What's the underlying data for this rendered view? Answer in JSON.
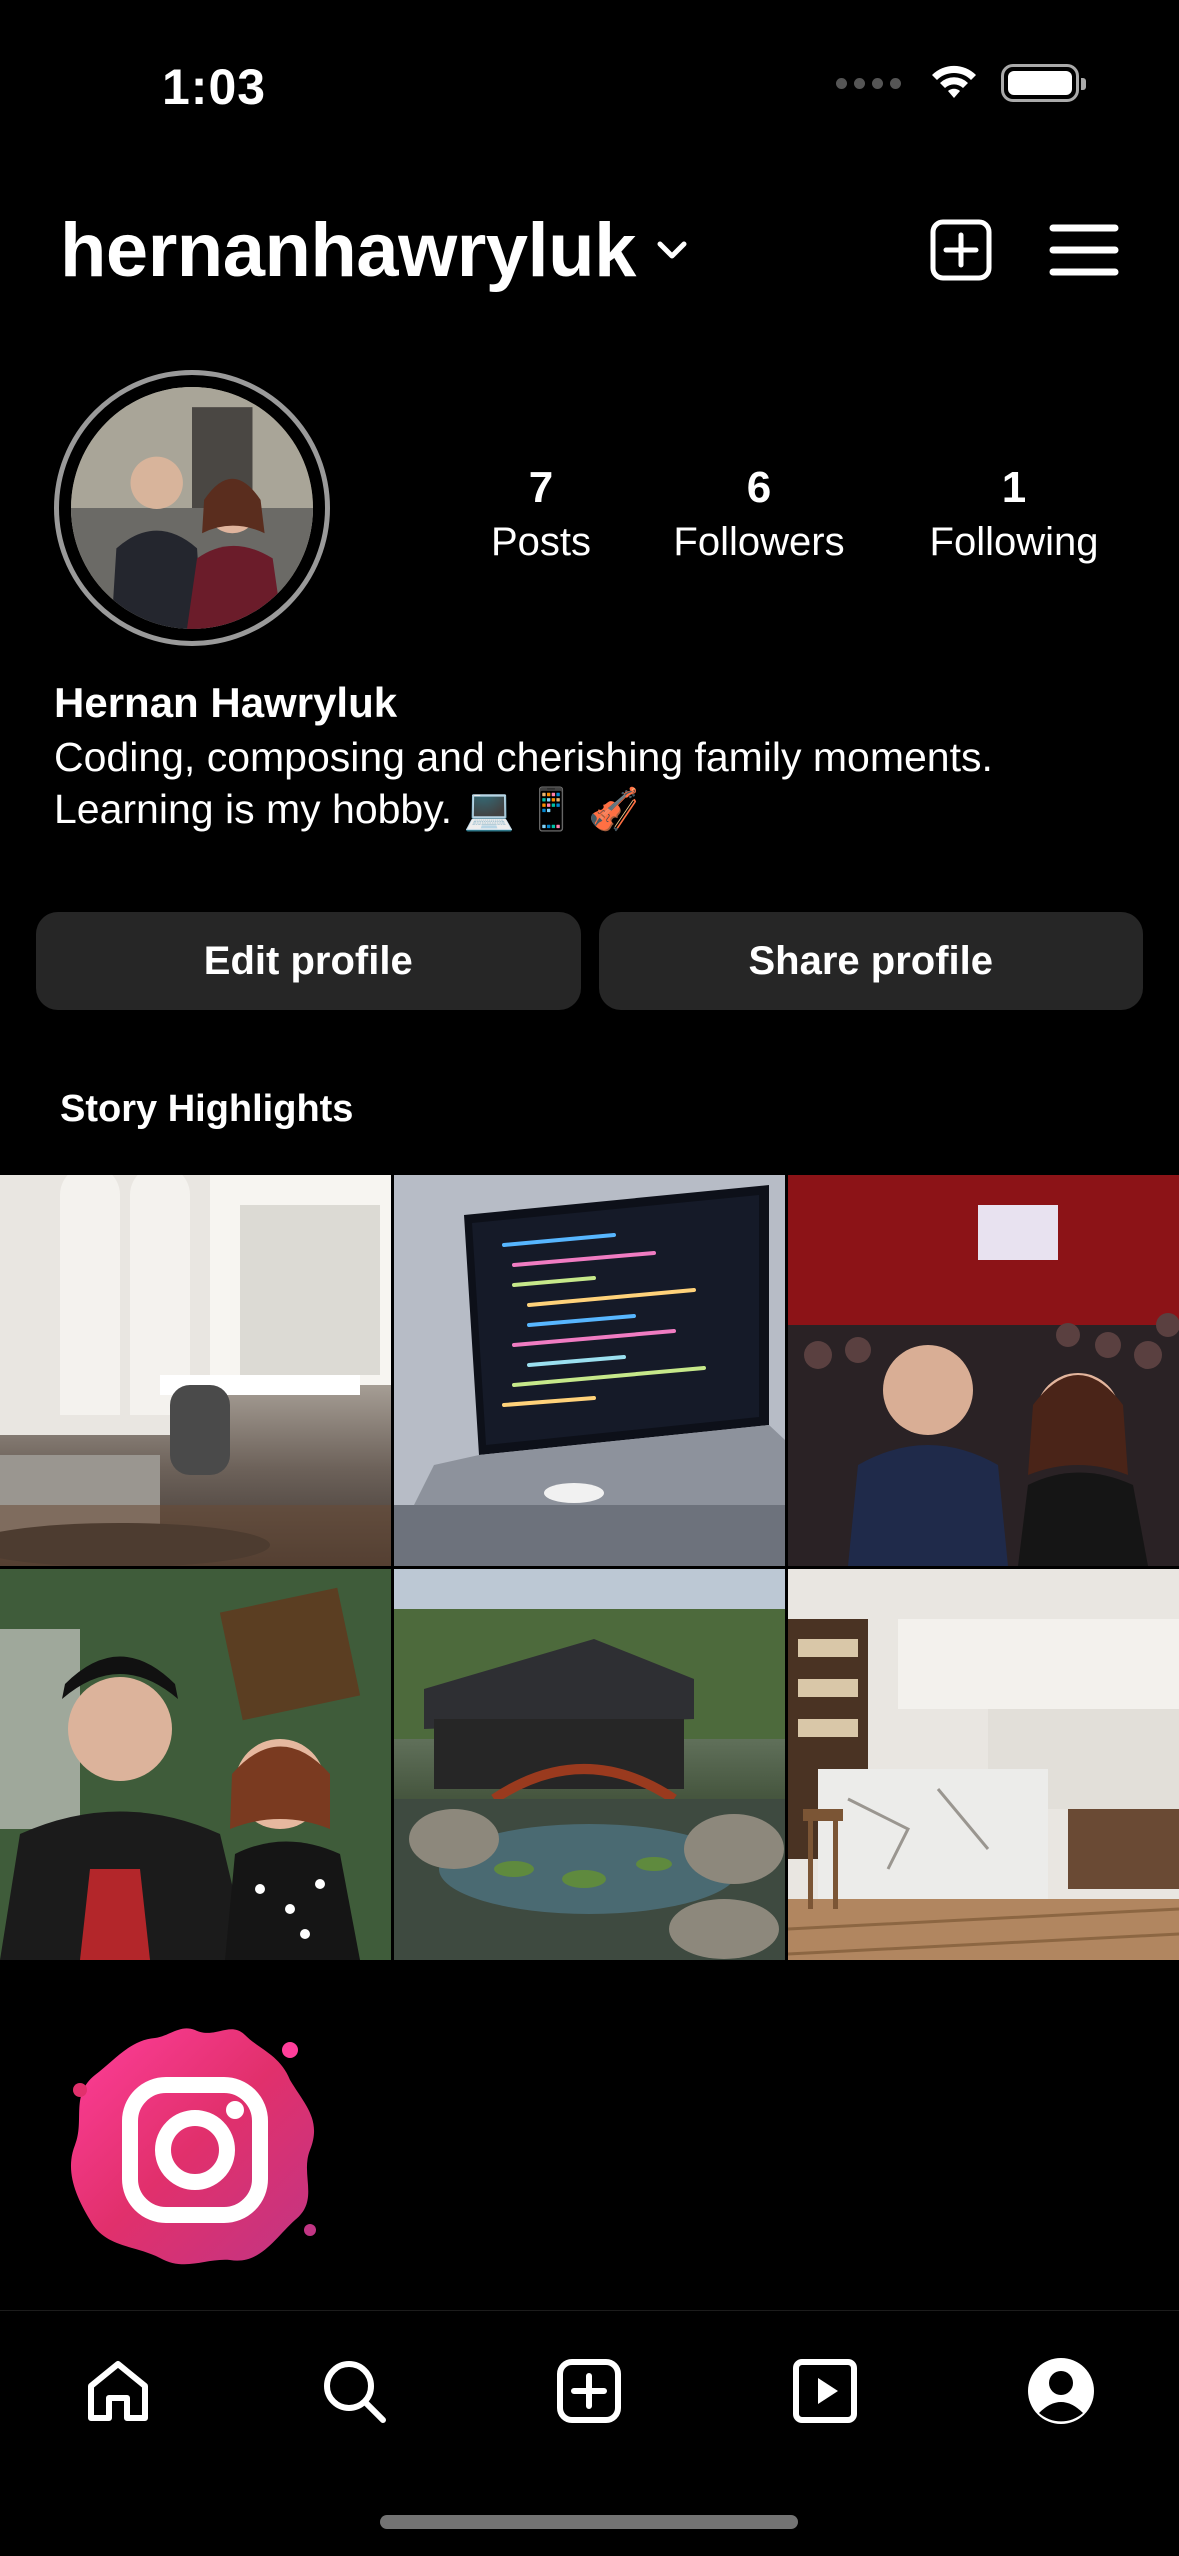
{
  "status_bar": {
    "time": "1:03"
  },
  "header": {
    "username": "hernanhawryluk"
  },
  "profile": {
    "stats": [
      {
        "key": "posts",
        "count": "7",
        "label": "Posts"
      },
      {
        "key": "followers",
        "count": "6",
        "label": "Followers"
      },
      {
        "key": "following",
        "count": "1",
        "label": "Following"
      }
    ],
    "full_name": "Hernan Hawryluk",
    "bio_line_1": "Coding, composing and cherishing family moments.",
    "bio_line_2": "Learning is my hobby. 💻 📱 🎻"
  },
  "actions": {
    "edit_label": "Edit profile",
    "share_label": "Share profile"
  },
  "highlights": {
    "title": "Story Highlights"
  },
  "grid": {
    "tiles": [
      {
        "icon": "bedroom-photo"
      },
      {
        "icon": "laptop-code-photo"
      },
      {
        "icon": "concert-selfie-photo"
      },
      {
        "icon": "couple-selfie-photo"
      },
      {
        "icon": "japanese-garden-photo"
      },
      {
        "icon": "kitchen-photo"
      }
    ]
  },
  "tabbar": {
    "items": [
      {
        "icon": "home-icon"
      },
      {
        "icon": "search-icon"
      },
      {
        "icon": "create-icon"
      },
      {
        "icon": "reels-icon"
      },
      {
        "icon": "profile-icon"
      }
    ]
  },
  "colors": {
    "background": "#000000",
    "button_bg": "#262626",
    "instagram_gradient": [
      "#feda75",
      "#fa7e1e",
      "#d62976",
      "#962fbf",
      "#4f5bd5"
    ]
  }
}
